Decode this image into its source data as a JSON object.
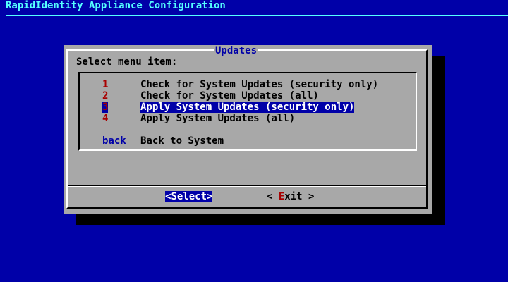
{
  "app_title": "RapidIdentity Appliance Configuration",
  "dialog": {
    "title": "Updates",
    "prompt": "Select menu item:",
    "menu_items": [
      {
        "tag": "1",
        "label": "Check for System Updates (security only)"
      },
      {
        "tag": "2",
        "label": "Check for System Updates (all)"
      },
      {
        "tag": "3",
        "label": "Apply System Updates (security only)",
        "selected": true
      },
      {
        "tag": "4",
        "label": "Apply System Updates (all)"
      },
      {
        "tag": "back",
        "label": "Back to System"
      }
    ],
    "buttons": {
      "select": {
        "open": "<",
        "hot": "S",
        "rest": "elect",
        "close": ">"
      },
      "exit": {
        "open": "< ",
        "hot": "E",
        "rest": "xit",
        "close": " >"
      }
    }
  },
  "colors": {
    "background": "#0000a8",
    "dialog": "#a8a8a8",
    "title_text": "#55ffff",
    "tag_red": "#a80000",
    "highlight": "#0000a8"
  }
}
